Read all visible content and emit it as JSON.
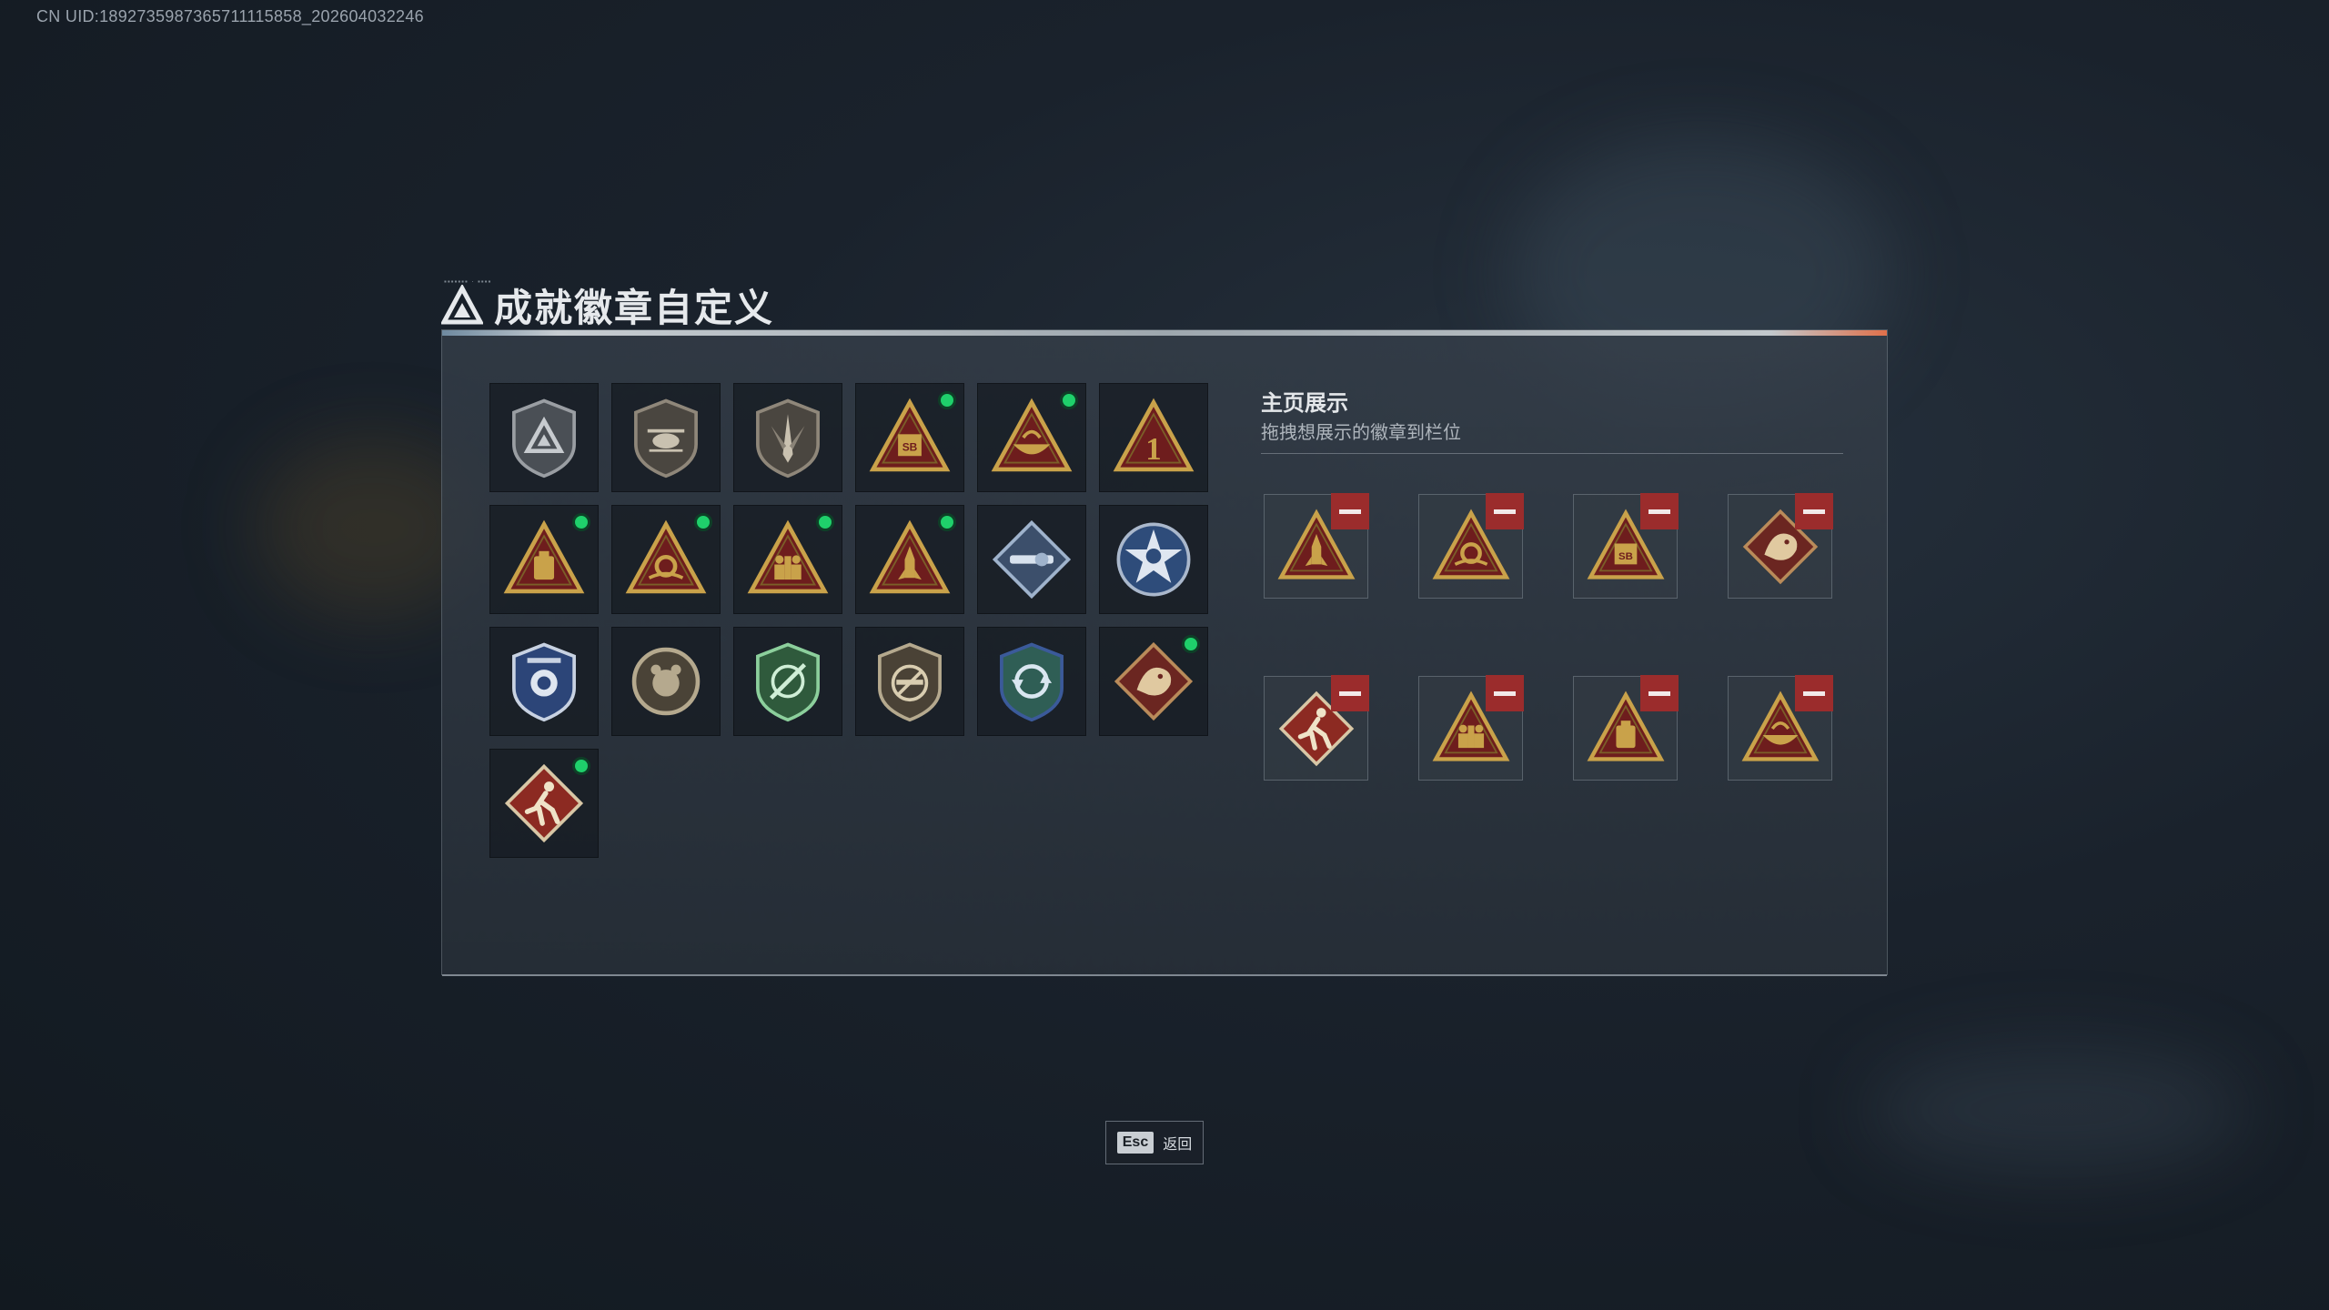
{
  "uid_text": "CN UID:1892735987365711115858_202604032246",
  "title": "成就徽章自定义",
  "colors": {
    "accent_green": "#1fd06b",
    "remove_red": "#9b2c2c",
    "gold": "#c9a24a",
    "triangle_red": "#7a1f1f"
  },
  "badge_grid": [
    {
      "icon": "triangle-emblem-shield-icon",
      "new": false
    },
    {
      "icon": "helicopter-shield-icon",
      "new": false
    },
    {
      "icon": "blade-shield-icon",
      "new": false
    },
    {
      "icon": "sb-triangle-icon",
      "new": true
    },
    {
      "icon": "bowl-triangle-icon",
      "new": true
    },
    {
      "icon": "number-one-triangle-icon",
      "new": false
    },
    {
      "icon": "backpack-triangle-icon",
      "new": true
    },
    {
      "icon": "gear-hand-triangle-icon",
      "new": true
    },
    {
      "icon": "soldiers-triangle-icon",
      "new": true
    },
    {
      "icon": "rocket-triangle-icon",
      "new": true
    },
    {
      "icon": "rocket-launcher-diamond-icon",
      "new": false
    },
    {
      "icon": "skull-star-emblem-icon",
      "new": false
    },
    {
      "icon": "police-badge-icon",
      "new": false
    },
    {
      "icon": "bear-round-emblem-icon",
      "new": false
    },
    {
      "icon": "crosshair-green-shield-icon",
      "new": false
    },
    {
      "icon": "rifle-no-sign-shield-icon",
      "new": false
    },
    {
      "icon": "cycle-arrows-blue-shield-icon",
      "new": false
    },
    {
      "icon": "dragon-diamond-icon",
      "new": true
    },
    {
      "icon": "runner-diamond-icon",
      "new": true
    }
  ],
  "showcase": {
    "title": "主页展示",
    "subtitle": "拖拽想展示的徽章到栏位",
    "slots": [
      {
        "icon": "rocket-triangle-icon"
      },
      {
        "icon": "gear-hand-triangle-icon"
      },
      {
        "icon": "sb-triangle-icon"
      },
      {
        "icon": "dragon-diamond-icon"
      },
      {
        "icon": "runner-diamond-icon"
      },
      {
        "icon": "soldiers-triangle-icon"
      },
      {
        "icon": "backpack-triangle-icon"
      },
      {
        "icon": "bowl-triangle-icon"
      }
    ]
  },
  "esc": {
    "key": "Esc",
    "label": "返回"
  }
}
